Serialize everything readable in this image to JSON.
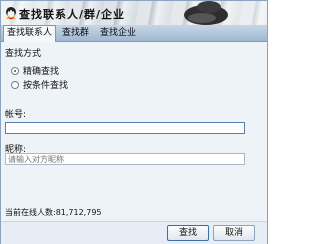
{
  "window": {
    "title": "查找联系人/群/企业"
  },
  "tabs": [
    {
      "label": "查找联系人",
      "active": true
    },
    {
      "label": "查找群",
      "active": false
    },
    {
      "label": "查找企业",
      "active": false
    }
  ],
  "search": {
    "section_title": "查找方式",
    "options": [
      {
        "label": "精确查找",
        "checked": true
      },
      {
        "label": "按条件查找",
        "checked": false
      }
    ],
    "account_label": "帐号:",
    "account_value": "",
    "nickname_label": "昵称:",
    "nickname_placeholder": "请输入对方昵称"
  },
  "status": {
    "online_text": "当前在线人数:81,712,795"
  },
  "buttons": {
    "search_label": "查找",
    "cancel_label": "取消"
  },
  "colors": {
    "accent": "#5b7fb0",
    "tab_bar": "#9fb8d1"
  }
}
